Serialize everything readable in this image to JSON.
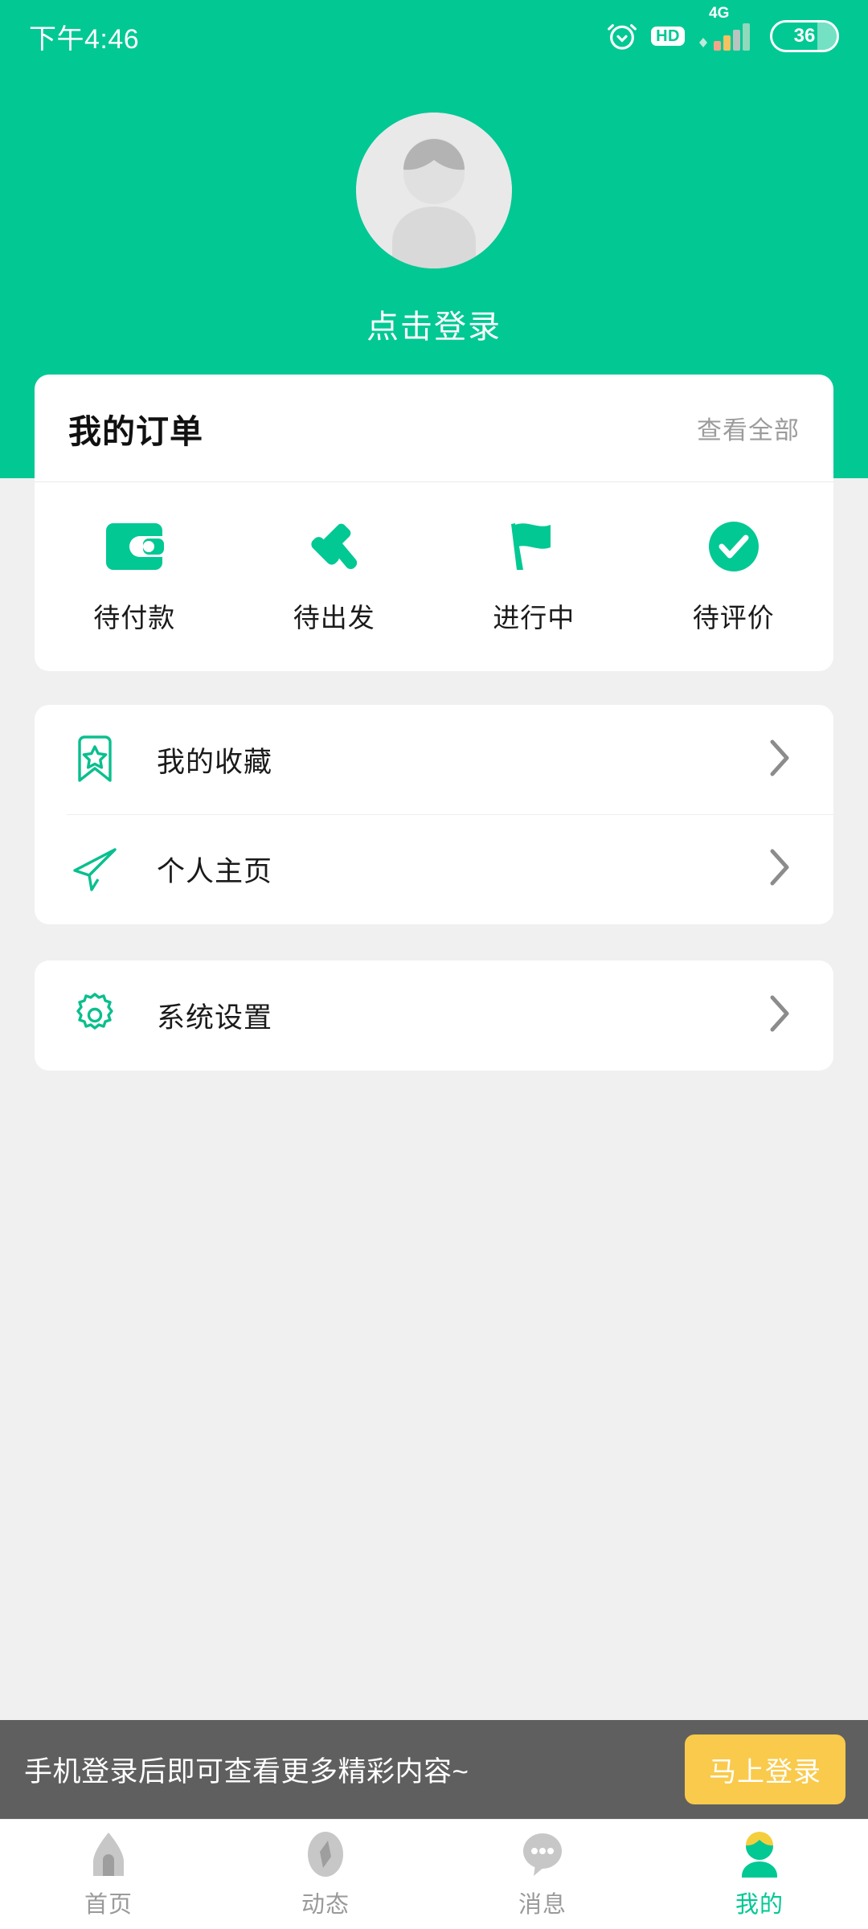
{
  "theme": {
    "brand_green": "#02C894",
    "page_bg": "#F0F0F0",
    "card_bg": "#FFFFFF",
    "banner_bg": "#5F5F5F",
    "accent_yellow": "#F9CA4C",
    "muted_text": "#9C9C9C"
  },
  "status_bar": {
    "time": "下午4:46",
    "alarm_icon": "alarm-clock-icon",
    "hd_label": "HD",
    "network_label": "4G",
    "battery_level": "36"
  },
  "profile": {
    "avatar_icon": "default-avatar-icon",
    "login_prompt": "点击登录"
  },
  "orders": {
    "title": "我的订单",
    "view_all": "查看全部",
    "items": [
      {
        "label": "待付款",
        "icon": "wallet-icon"
      },
      {
        "label": "待出发",
        "icon": "gavel-icon"
      },
      {
        "label": "进行中",
        "icon": "flag-icon"
      },
      {
        "label": "待评价",
        "icon": "check-circle-icon"
      }
    ]
  },
  "menu_groups": [
    {
      "rows": [
        {
          "label": "我的收藏",
          "icon": "bookmark-star-icon",
          "chevron": "chevron-right-icon"
        },
        {
          "label": "个人主页",
          "icon": "paper-plane-icon",
          "chevron": "chevron-right-icon"
        }
      ]
    },
    {
      "rows": [
        {
          "label": "系统设置",
          "icon": "gear-icon",
          "chevron": "chevron-right-icon"
        }
      ]
    }
  ],
  "login_banner": {
    "message": "手机登录后即可查看更多精彩内容~",
    "button_label": "马上登录"
  },
  "tabbar": {
    "tabs": [
      {
        "label": "首页",
        "icon": "home-icon",
        "active": false
      },
      {
        "label": "动态",
        "icon": "compass-icon",
        "active": false
      },
      {
        "label": "消息",
        "icon": "chat-bubble-icon",
        "active": false
      },
      {
        "label": "我的",
        "icon": "person-icon",
        "active": true
      }
    ]
  }
}
